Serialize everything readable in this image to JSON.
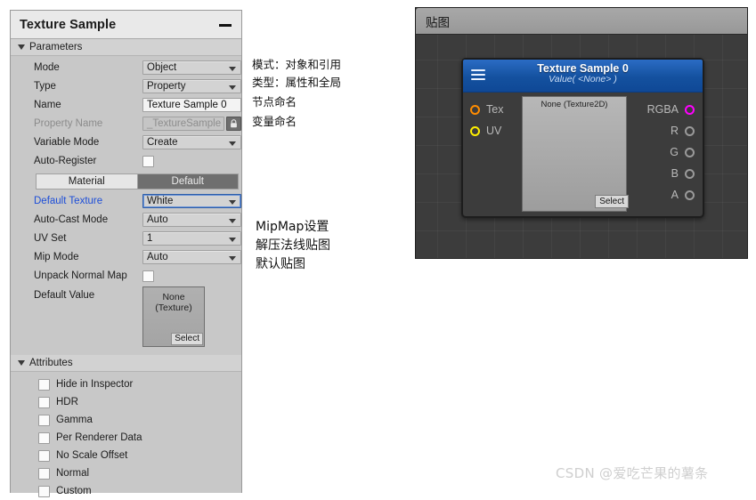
{
  "inspector": {
    "title": "Texture Sample",
    "minimize_icon": "minimize-icon",
    "sections": {
      "parameters": {
        "label": "Parameters",
        "rows": [
          {
            "label": "Mode",
            "control": "dropdown",
            "value": "Object"
          },
          {
            "label": "Type",
            "control": "dropdown",
            "value": "Property"
          },
          {
            "label": "Name",
            "control": "textfield",
            "value": "Texture Sample 0"
          },
          {
            "label": "Property Name",
            "control": "locked",
            "value": "_TextureSample",
            "lock_icon": "lock-icon"
          },
          {
            "label": "Variable Mode",
            "control": "dropdown",
            "value": "Create"
          },
          {
            "label": "Auto-Register",
            "control": "checkbox",
            "checked": false
          }
        ],
        "toggle_group": {
          "left_label": "Material",
          "right_label": "Default",
          "selected": "Default"
        },
        "rows2": [
          {
            "label": "Default Texture",
            "control": "dropdown",
            "value": "White",
            "highlight": true
          },
          {
            "label": "Auto-Cast Mode",
            "control": "dropdown",
            "value": "Auto"
          },
          {
            "label": "UV Set",
            "control": "dropdown",
            "value": "1"
          },
          {
            "label": "Mip Mode",
            "control": "dropdown",
            "value": "Auto"
          },
          {
            "label": "Unpack Normal Map",
            "control": "checkbox",
            "checked": false
          }
        ],
        "default_value": {
          "label": "Default Value",
          "object_line1": "None",
          "object_line2": "(Texture)",
          "select_label": "Select"
        }
      },
      "attributes": {
        "label": "Attributes",
        "items": [
          {
            "label": "Hide in Inspector",
            "checked": false
          },
          {
            "label": "HDR",
            "checked": false
          },
          {
            "label": "Gamma",
            "checked": false
          },
          {
            "label": "Per Renderer Data",
            "checked": false
          },
          {
            "label": "No Scale Offset",
            "checked": false
          },
          {
            "label": "Normal",
            "checked": false
          },
          {
            "label": "Custom",
            "checked": false
          }
        ]
      }
    }
  },
  "annotations": {
    "group1": {
      "line1": "模式：对象和引用",
      "line2": "类型：属性和全局",
      "line3": "节点命名",
      "line4": "变量命名"
    },
    "group2": {
      "line1": "MipMap设置",
      "line2": "解压法线贴图",
      "line3": "默认贴图"
    }
  },
  "graph": {
    "tab_label": "贴图",
    "node": {
      "menu_icon": "hamburger-menu-icon",
      "title": "Texture Sample 0",
      "subtitle": "Value( <None> )",
      "inputs": [
        {
          "name": "Tex",
          "color": "#ff8c00"
        },
        {
          "name": "UV",
          "color": "#ffef00"
        }
      ],
      "outputs": [
        {
          "name": "RGBA",
          "color": "#ff00ff"
        },
        {
          "name": "R",
          "color": "#9a9a9a"
        },
        {
          "name": "G",
          "color": "#9a9a9a"
        },
        {
          "name": "B",
          "color": "#9a9a9a"
        },
        {
          "name": "A",
          "color": "#9a9a9a"
        }
      ],
      "preview": {
        "label": "None (Texture2D)",
        "select_label": "Select"
      }
    }
  },
  "watermark": {
    "text": "CSDN @爱吃芒果的薯条"
  },
  "colors": {
    "node_header": "#14519f",
    "panel_bg": "#c8c8c8",
    "graph_bg": "#3c3c3c",
    "link_text": "#1d4ed8",
    "rgba_port": "#ff00ff",
    "tex_port": "#ff8c00",
    "uv_port": "#ffef00"
  }
}
